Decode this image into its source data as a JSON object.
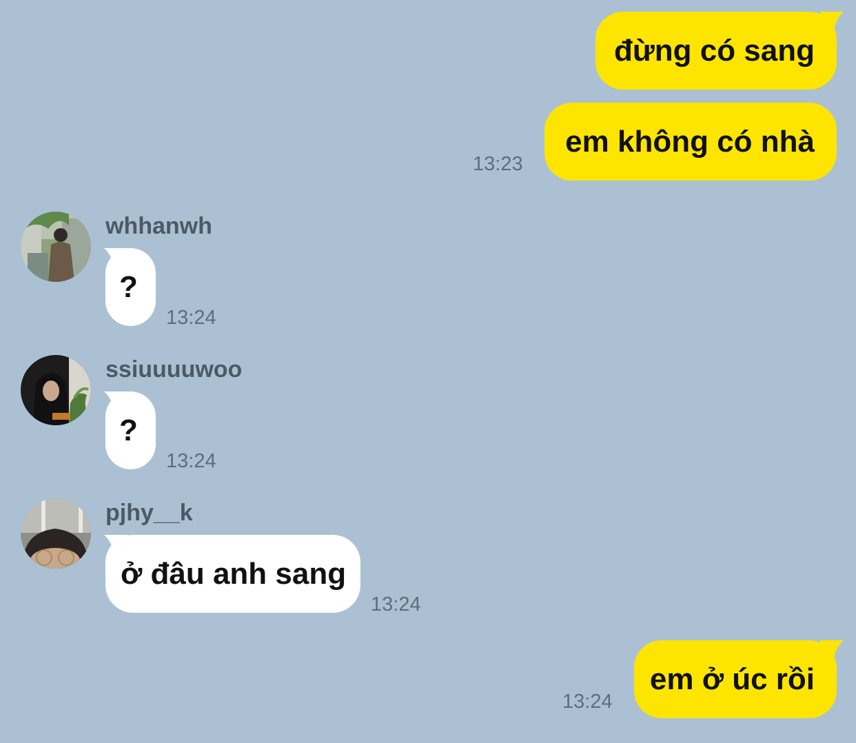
{
  "conversation": {
    "outgoing_1": {
      "text": "đừng có sang"
    },
    "outgoing_2": {
      "text": "em không có nhà",
      "time": "13:23"
    },
    "incoming_1": {
      "sender": "whhanwh",
      "text": "?",
      "time": "13:24",
      "avatar_icon": "avatar-person-street-icon"
    },
    "incoming_2": {
      "sender": "ssiuuuuwoo",
      "text": "?",
      "time": "13:24",
      "avatar_icon": "avatar-person-hood-icon"
    },
    "incoming_3": {
      "sender": "pjhy__k",
      "text": "ở đâu anh sang",
      "time": "13:24",
      "avatar_icon": "avatar-person-glasses-icon"
    },
    "outgoing_3": {
      "text": "em ở úc rồi",
      "time": "13:24"
    }
  },
  "colors": {
    "background": "#abc1d3",
    "outgoing_bubble": "#fee500",
    "incoming_bubble": "#ffffff",
    "timestamp": "#5f6d7a",
    "sender_name": "#4d5965"
  }
}
